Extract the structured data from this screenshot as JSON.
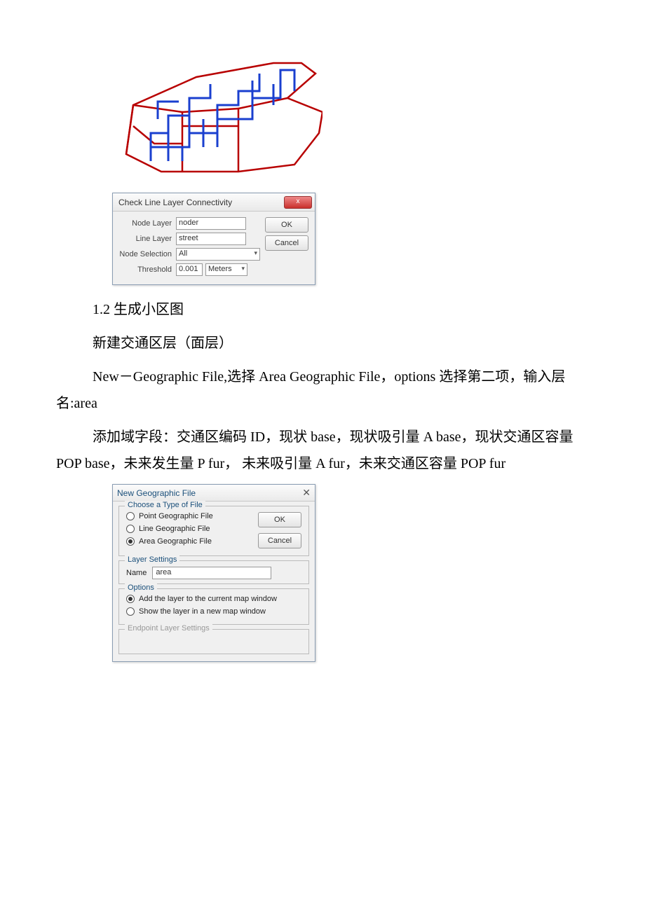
{
  "dialog_check": {
    "title": "Check Line Layer Connectivity",
    "close_glyph": "x",
    "node_layer_label": "Node Layer",
    "node_layer_value": "noder",
    "line_layer_label": "Line Layer",
    "line_layer_value": "street",
    "node_selection_label": "Node Selection",
    "node_selection_value": "All",
    "threshold_label": "Threshold",
    "threshold_value": "0.001",
    "threshold_units": "Meters",
    "ok_label": "OK",
    "cancel_label": "Cancel"
  },
  "text": {
    "sec12": "1.2 生成小区图",
    "bullet1": " 新建交通区层（面层）",
    "bullet2": " New－Geographic File,选择 Area Geographic File，options 选择第二项，输入层名:area",
    "bullet3": " 添加域字段：交通区编码 ID，现状 base，现状吸引量 A base，现状交通区容量 POP base，未来发生量 P fur， 未来吸引量 A fur，未来交通区容量 POP fur"
  },
  "dialog_new": {
    "title": "New Geographic File",
    "close_glyph": "✕",
    "group_type": "Choose a Type of File",
    "opt_point": "Point Geographic File",
    "opt_line": "Line Geographic File",
    "opt_area": "Area Geographic File",
    "ok_label": "OK",
    "cancel_label": "Cancel",
    "group_layer": "Layer Settings",
    "name_label": "Name",
    "name_value": "area",
    "group_options": "Options",
    "opt_add": "Add the layer to the current map window",
    "opt_show": "Show the layer in a new map window",
    "group_endpoint": "Endpoint Layer Settings"
  }
}
